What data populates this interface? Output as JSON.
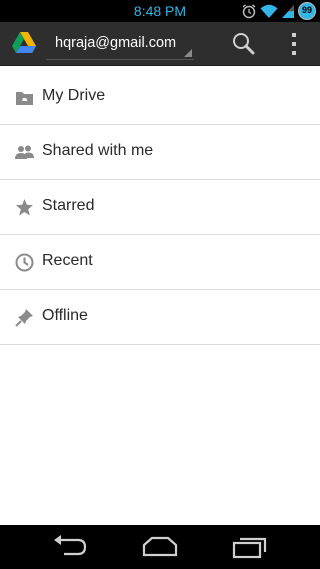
{
  "status_bar": {
    "time": "8:48 PM",
    "battery": "99"
  },
  "action_bar": {
    "account": "hqraja@gmail.com"
  },
  "drive_menu": {
    "items": [
      {
        "label": "My Drive",
        "icon": "folder-icon"
      },
      {
        "label": "Shared with me",
        "icon": "people-icon"
      },
      {
        "label": "Starred",
        "icon": "star-icon"
      },
      {
        "label": "Recent",
        "icon": "clock-icon"
      },
      {
        "label": "Offline",
        "icon": "pin-icon"
      }
    ]
  },
  "colors": {
    "status_time": "#33b5e5",
    "action_bar": "#2e2e2e",
    "icon_gray": "#8a8a8a"
  }
}
